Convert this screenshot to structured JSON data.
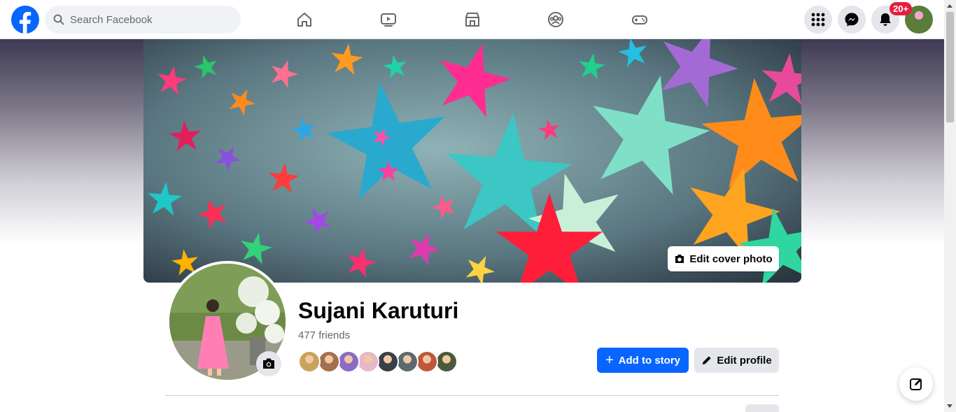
{
  "header": {
    "search_placeholder": "Search Facebook",
    "notification_badge": "20+",
    "nav_icons": [
      "home-icon",
      "watch-icon",
      "marketplace-icon",
      "groups-icon",
      "gaming-icon"
    ],
    "right_icons": [
      "menu-grid-icon",
      "messenger-icon",
      "notifications-icon",
      "account-avatar"
    ]
  },
  "cover": {
    "edit_cover_label": "Edit cover photo"
  },
  "profile": {
    "name": "Sujani Karuturi",
    "friends_count": "477 friends",
    "friend_avatar_colors": [
      "#c9a35b",
      "#a4704e",
      "#8a6cc4",
      "#e6b8c9",
      "#3a3f4a",
      "#5b6a6f",
      "#c0573b",
      "#4b5a3a"
    ]
  },
  "actions": {
    "add_story_label": "Add to story",
    "edit_profile_label": "Edit profile"
  },
  "colors": {
    "brand_blue": "#0866ff",
    "badge_red": "#e41e3f",
    "secondary_button": "#e4e6eb"
  }
}
